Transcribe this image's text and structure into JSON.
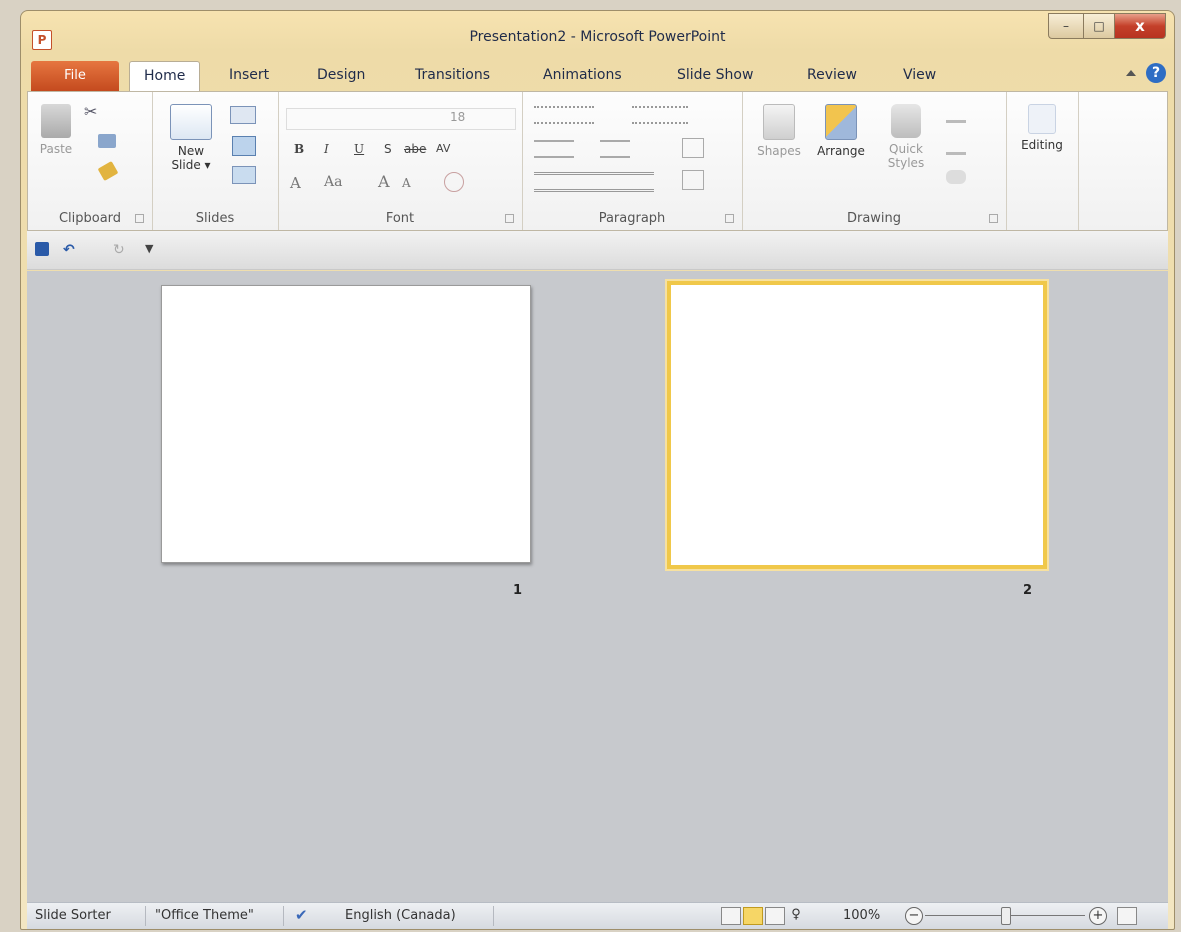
{
  "titlebar": {
    "app_icon": "P",
    "title": "Presentation2 - Microsoft PowerPoint",
    "minimize": "–",
    "maximize": "□",
    "close": "x"
  },
  "tabs": [
    {
      "label": "File"
    },
    {
      "label": "Home"
    },
    {
      "label": "Insert"
    },
    {
      "label": "Design"
    },
    {
      "label": "Transitions"
    },
    {
      "label": "Animations"
    },
    {
      "label": "Slide Show"
    },
    {
      "label": "Review"
    },
    {
      "label": "View"
    }
  ],
  "help": "?",
  "ribbon": {
    "clipboard": {
      "label": "Clipboard",
      "paste": "Paste"
    },
    "slides": {
      "label": "Slides",
      "new_slide_1": "New",
      "new_slide_2": "Slide ▾"
    },
    "font": {
      "label": "Font",
      "size": "18",
      "bold": "B",
      "italic": "I",
      "underline": "U",
      "shadow": "S",
      "strike": "abe",
      "spacing": "AV",
      "color": "A",
      "case": "Aa",
      "grow": "A",
      "shrink": "A"
    },
    "paragraph": {
      "label": "Paragraph"
    },
    "drawing": {
      "label": "Drawing",
      "shapes": "Shapes",
      "arrange": "Arrange",
      "quick_styles_1": "Quick",
      "quick_styles_2": "Styles"
    },
    "editing": {
      "label": "Editing"
    }
  },
  "slides": [
    {
      "number": "1",
      "selected": false
    },
    {
      "number": "2",
      "selected": true
    }
  ],
  "statusbar": {
    "view_name": "Slide Sorter",
    "theme": "\"Office Theme\"",
    "language": "English (Canada)",
    "zoom": "100%",
    "zoom_out": "−",
    "zoom_in": "+"
  },
  "colors": {
    "file_tab": "#c44a1e",
    "selection": "#f0c84a",
    "workspace": "#c7c9cd"
  }
}
